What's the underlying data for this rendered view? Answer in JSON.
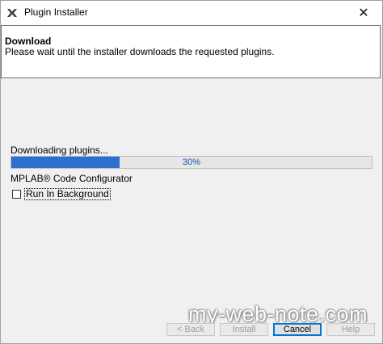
{
  "window": {
    "title": "Plugin Installer",
    "close_glyph": "✕"
  },
  "header": {
    "title": "Download",
    "description": "Please wait until the installer downloads the requested plugins."
  },
  "download": {
    "status": "Downloading plugins...",
    "progress_percent": 30,
    "progress_label": "30%",
    "plugin_name": "MPLAB® Code Configurator",
    "background_label": "Run In Background",
    "background_checked": false
  },
  "buttons": {
    "back": "< Back",
    "install": "Install",
    "cancel": "Cancel",
    "help": "Help"
  },
  "watermark": "my-web-note.com",
  "colors": {
    "progress_fill": "#2b6fd1",
    "accent": "#0078d7"
  }
}
